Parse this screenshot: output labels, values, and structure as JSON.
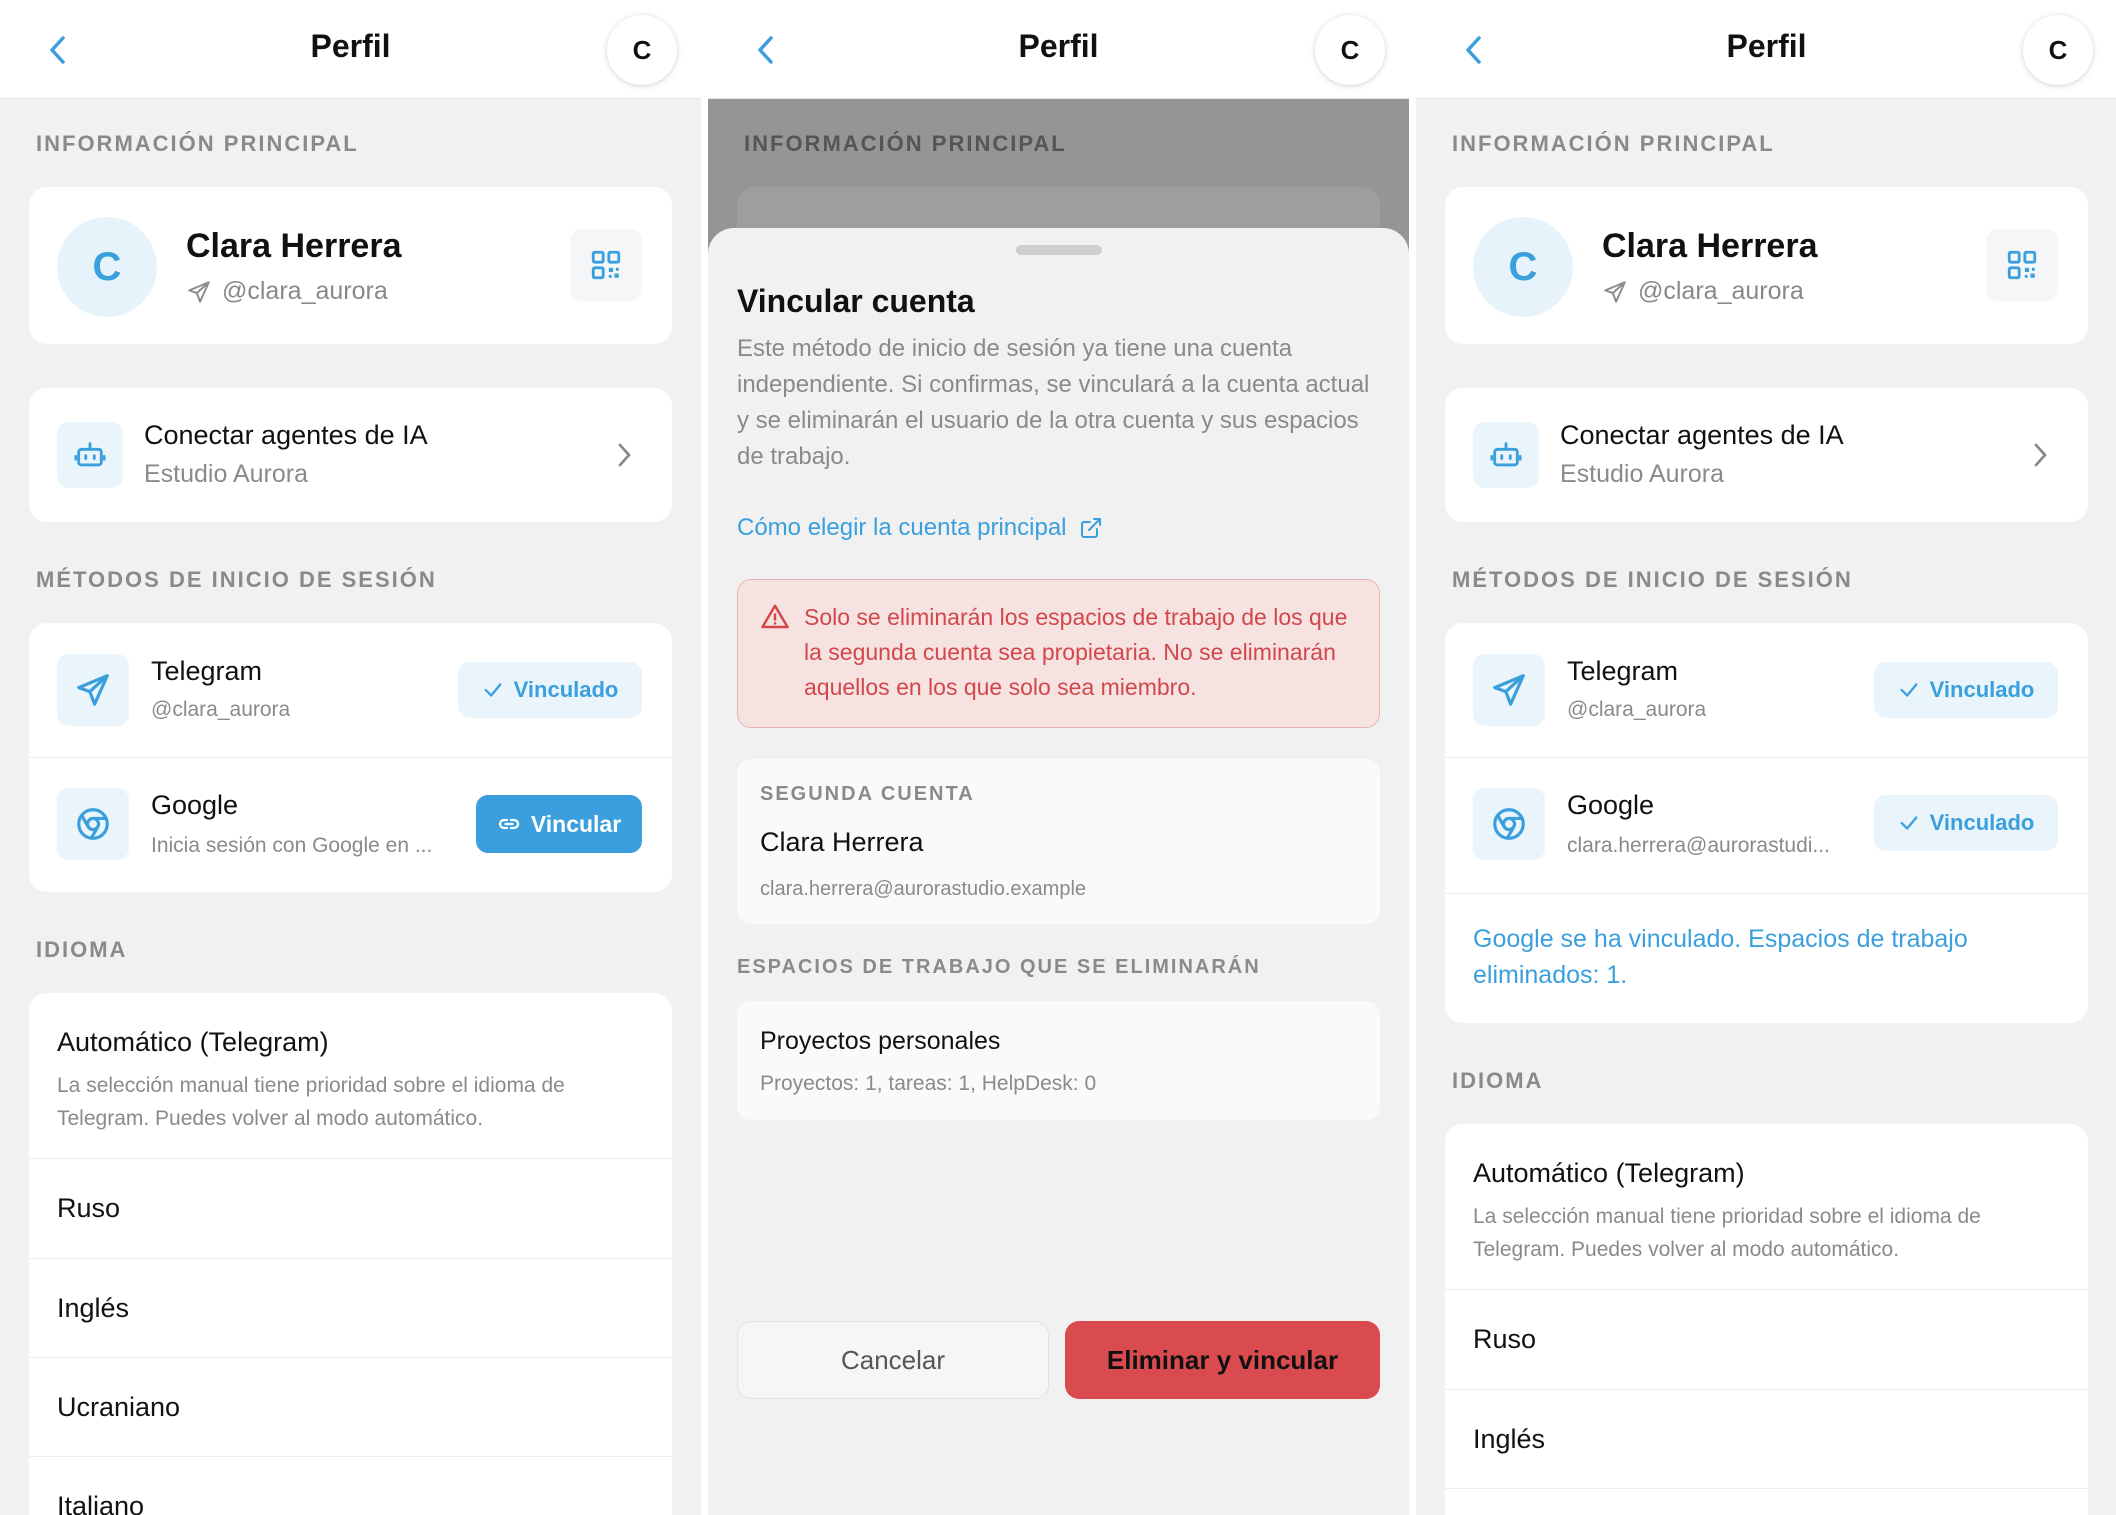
{
  "header": {
    "title": "Perfil",
    "avatar_initial": "C"
  },
  "sections": {
    "main_info": "INFORMACIÓN PRINCIPAL",
    "login_methods": "MÉTODOS DE INICIO DE SESIÓN",
    "language": "IDIOMA"
  },
  "profile": {
    "initial": "C",
    "name": "Clara Herrera",
    "username": "@clara_aurora"
  },
  "ai_agents": {
    "title": "Conectar agentes de IA",
    "subtitle": "Estudio Aurora"
  },
  "telegram": {
    "name": "Telegram",
    "handle": "@clara_aurora",
    "status": "Vinculado"
  },
  "google": {
    "name": "Google",
    "hint": "Inicia sesión con Google en ...",
    "link_label": "Vincular",
    "email": "clara.herrera@aurorastudi...",
    "status": "Vinculado",
    "success": "Google se ha vinculado. Espacios de trabajo eliminados: 1."
  },
  "language": {
    "auto_title": "Automático (Telegram)",
    "auto_desc": "La selección manual tiene prioridad sobre el idioma de Telegram. Puedes volver al modo automático.",
    "items": [
      "Ruso",
      "Inglés",
      "Ucraniano",
      "Italiano"
    ]
  },
  "dialog": {
    "title": "Vincular cuenta",
    "description": "Este método de inicio de sesión ya tiene una cuenta independiente. Si confirmas, se vinculará a la cuenta actual y se eliminarán el usuario de la otra cuenta y sus espacios de trabajo.",
    "help_link": "Cómo elegir la cuenta principal",
    "warning": "Solo se eliminarán los espacios de trabajo de los que la segunda cuenta sea propietaria. No se eliminarán aquellos en los que solo sea miembro.",
    "second_account_label": "SEGUNDA CUENTA",
    "second_account_name": "Clara Herrera",
    "second_account_email": "clara.herrera@aurorastudio.example",
    "workspaces_label": "ESPACIOS DE TRABAJO QUE SE ELIMINARÁN",
    "workspace_name": "Proyectos personales",
    "workspace_stats": "Proyectos: 1, tareas: 1, HelpDesk: 0",
    "cancel_label": "Cancelar",
    "confirm_label": "Eliminar y vincular"
  },
  "colors": {
    "accent": "#3a9fdc",
    "danger": "#d94b4e",
    "background": "#f1f1f1"
  }
}
